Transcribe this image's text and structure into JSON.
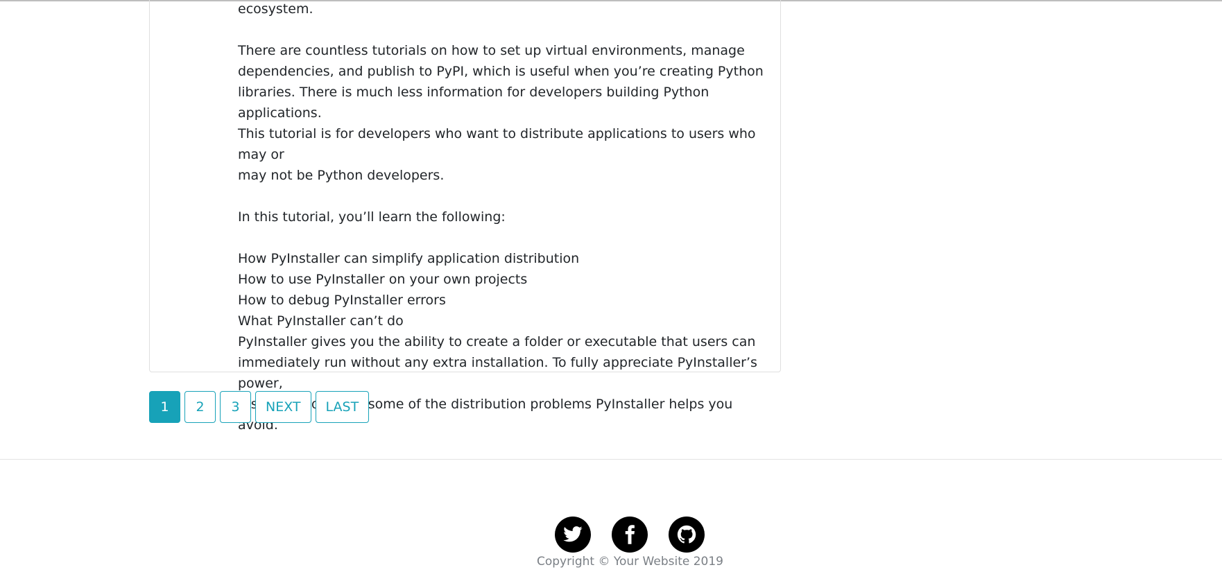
{
  "article": {
    "p0": "ecosystem.",
    "p1_lines": [
      "There are countless tutorials on how to set up virtual environments, manage",
      "dependencies, and publish to PyPI, which is useful when you’re creating Python",
      "libraries. There is much less information for developers building Python applications.",
      "This tutorial is for developers who want to distribute applications to users who may or",
      "may not be Python developers."
    ],
    "p2": "In this tutorial, you’ll learn the following:",
    "list": [
      "How PyInstaller can simplify application distribution",
      "How to use PyInstaller on your own projects",
      "How to debug PyInstaller errors",
      "What PyInstaller can’t do"
    ],
    "p3_lines": [
      "PyInstaller gives you the ability to create a folder or executable that users can",
      "immediately run without any extra installation. To fully appreciate PyInstaller’s power,",
      "it’s useful to revisit some of the distribution problems PyInstaller helps you avoid."
    ]
  },
  "pagination": {
    "pages": [
      "1",
      "2",
      "3"
    ],
    "active": "1",
    "next": "NEXT",
    "last": "LAST"
  },
  "footer": {
    "icons": [
      "twitter-icon",
      "facebook-icon",
      "github-icon"
    ],
    "copyright": "Copyright © Your Website 2019"
  },
  "colors": {
    "accent": "#17a2b8",
    "text": "#212529",
    "muted": "#7a7f85"
  }
}
